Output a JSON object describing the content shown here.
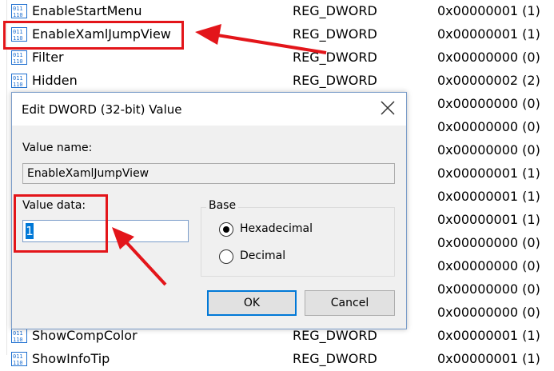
{
  "registry_rows": [
    {
      "name": "EnableStartMenu",
      "type": "REG_DWORD",
      "data": "0x00000001 (1)"
    },
    {
      "name": "EnableXamlJumpView",
      "type": "REG_DWORD",
      "data": "0x00000001 (1)"
    },
    {
      "name": "Filter",
      "type": "REG_DWORD",
      "data": "0x00000000 (0)"
    },
    {
      "name": "Hidden",
      "type": "REG_DWORD",
      "data": "0x00000002 (2)"
    },
    {
      "name": "",
      "type": "",
      "data": "0x00000000 (0)"
    },
    {
      "name": "",
      "type": "",
      "data": "0x00000000 (0)"
    },
    {
      "name": "",
      "type": "",
      "data": "0x00000000 (0)"
    },
    {
      "name": "",
      "type": "",
      "data": "0x00000001 (1)"
    },
    {
      "name": "",
      "type": "",
      "data": "0x00000001 (1)"
    },
    {
      "name": "",
      "type": "",
      "data": "0x00000001 (1)"
    },
    {
      "name": "",
      "type": "",
      "data": "0x00000000 (0)"
    },
    {
      "name": "",
      "type": "",
      "data": "0x00000000 (0)"
    },
    {
      "name": "",
      "type": "",
      "data": "0x00000000 (0)"
    },
    {
      "name": "",
      "type": "",
      "data": "0x00000000 (0)"
    },
    {
      "name": "ShowCompColor",
      "type": "REG_DWORD",
      "data": "0x00000001 (1)"
    },
    {
      "name": "ShowInfoTip",
      "type": "REG_DWORD",
      "data": "0x00000001 (1)"
    }
  ],
  "dialog": {
    "title": "Edit DWORD (32-bit) Value",
    "value_name_label": "Value name:",
    "value_name": "EnableXamlJumpView",
    "value_data_label": "Value data:",
    "value_data": "1",
    "base_label": "Base",
    "hex_label": "Hexadecimal",
    "dec_label": "Decimal",
    "selected_base": "Hexadecimal",
    "ok_label": "OK",
    "cancel_label": "Cancel"
  },
  "colors": {
    "highlight": "#e3151a",
    "selection": "#0078d7",
    "icon_blue": "#1e6fd0"
  },
  "icons": {
    "registry_value": "reg-dword-icon",
    "close": "close-icon",
    "annotation_arrow": "arrow-icon"
  }
}
